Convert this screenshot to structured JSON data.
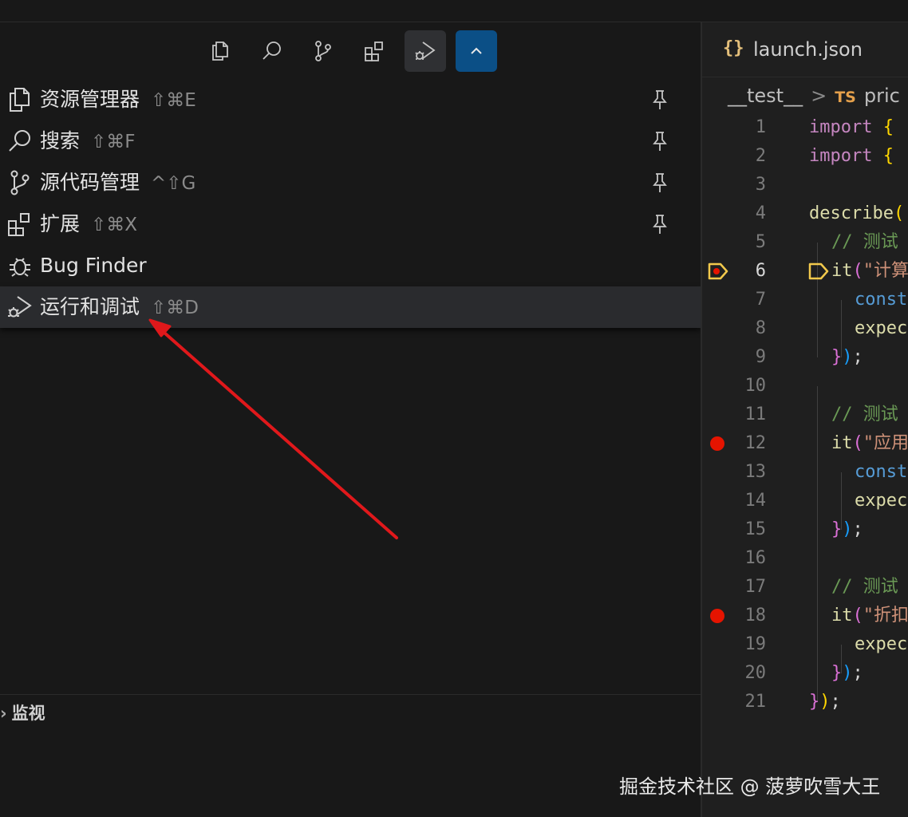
{
  "menu": {
    "items": [
      {
        "label": "资源管理器",
        "shortcut": "⇧⌘E"
      },
      {
        "label": "搜索",
        "shortcut": "⇧⌘F"
      },
      {
        "label": "源代码管理",
        "shortcut": "^⇧G"
      },
      {
        "label": "扩展",
        "shortcut": "⇧⌘X"
      },
      {
        "label": "Bug Finder",
        "shortcut": ""
      },
      {
        "label": "运行和调试",
        "shortcut": "⇧⌘D"
      }
    ]
  },
  "watch": {
    "chevron": "›",
    "title": "监视"
  },
  "watermark": "掘金技术社区 @ 菠萝吹雪大王",
  "editor": {
    "tab": {
      "icon": "{}",
      "label": "launch.json"
    },
    "breadcrumb": {
      "folder": "__test__",
      "separator": ">",
      "lang_badge": "TS",
      "file": "pric"
    },
    "lines": [
      {
        "n": "1",
        "code": "import {"
      },
      {
        "n": "2",
        "code": "import {"
      },
      {
        "n": "3",
        "code": ""
      },
      {
        "n": "4",
        "code": "describe("
      },
      {
        "n": "5",
        "code": "// 测试"
      },
      {
        "n": "6",
        "code": "it(\"计算"
      },
      {
        "n": "7",
        "code": "const"
      },
      {
        "n": "8",
        "code": "expec"
      },
      {
        "n": "9",
        "code": "});"
      },
      {
        "n": "10",
        "code": ""
      },
      {
        "n": "11",
        "code": "// 测试"
      },
      {
        "n": "12",
        "code": "it(\"应用"
      },
      {
        "n": "13",
        "code": "const"
      },
      {
        "n": "14",
        "code": "expec"
      },
      {
        "n": "15",
        "code": "});"
      },
      {
        "n": "16",
        "code": ""
      },
      {
        "n": "17",
        "code": "// 测试"
      },
      {
        "n": "18",
        "code": "it(\"折扣"
      },
      {
        "n": "19",
        "code": "expec"
      },
      {
        "n": "20",
        "code": "});"
      },
      {
        "n": "21",
        "code": "});"
      }
    ]
  },
  "colors": {
    "accent": "#0b4f86",
    "breakpoint": "#e51400",
    "debug_marker": "#f2c94c",
    "annotation_arrow": "#e0181b"
  }
}
